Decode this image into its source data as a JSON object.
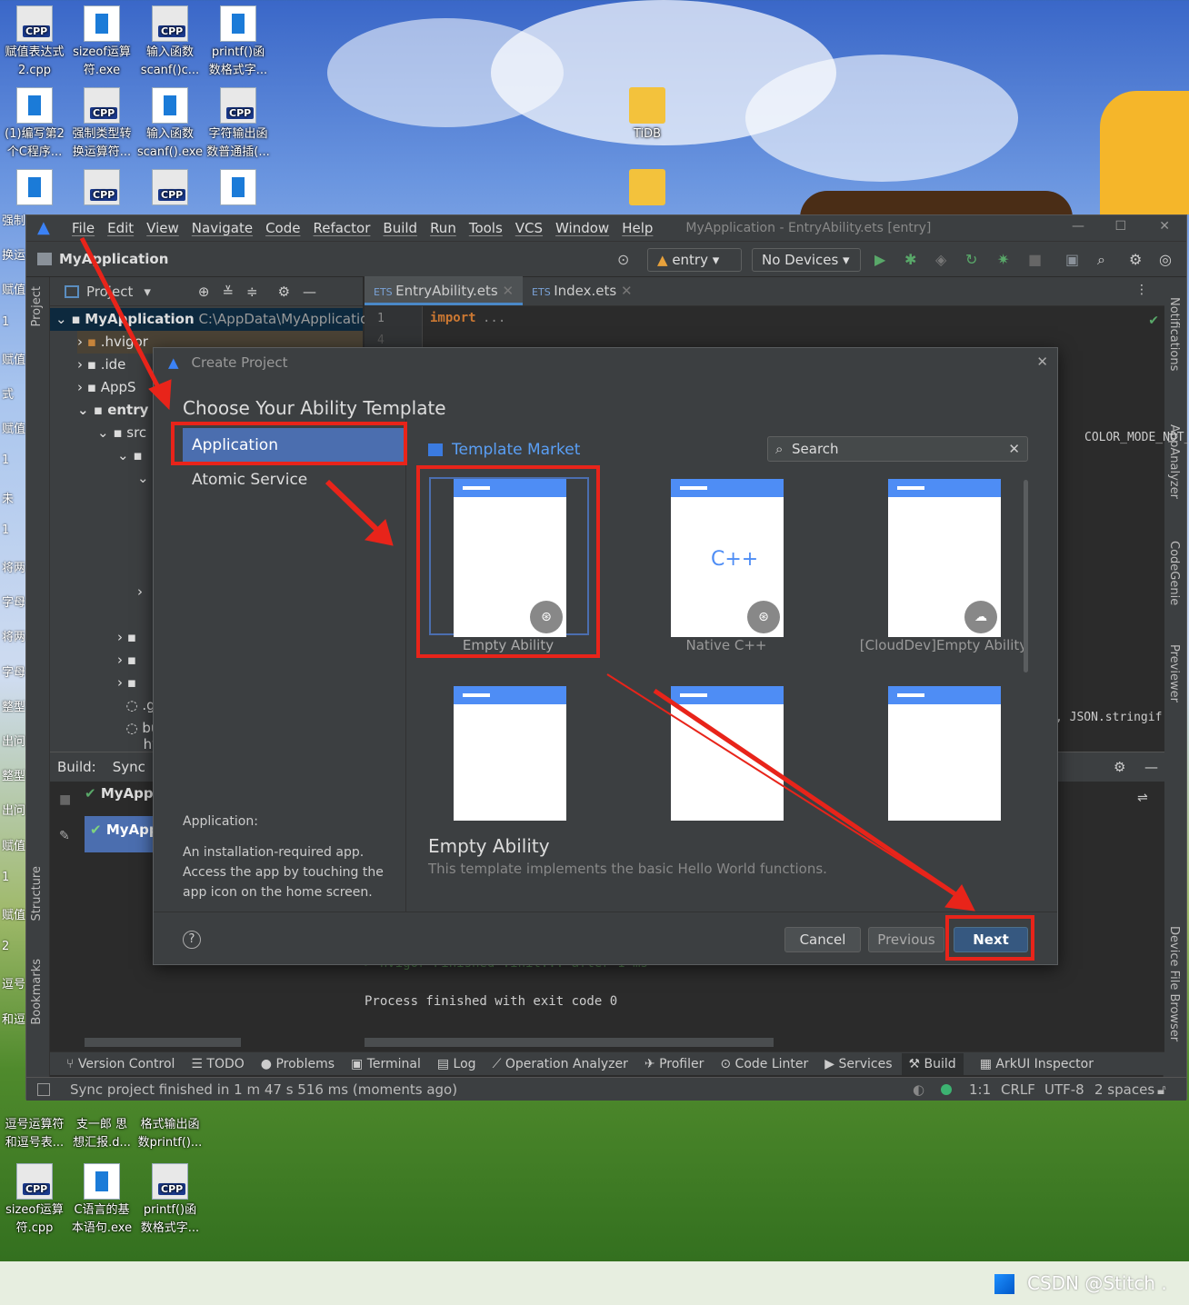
{
  "desktop": {
    "icons_top": [
      {
        "label1": "赋值表达式",
        "label2": "2.cpp",
        "type": "cpp"
      },
      {
        "label1": "sizeof运算",
        "label2": "符.exe",
        "type": "exe"
      },
      {
        "label1": "输入函数",
        "label2": "scanf()c...",
        "type": "cpp"
      },
      {
        "label1": "printf()函",
        "label2": "数格式字...",
        "type": "exe"
      },
      {
        "label1": "(1)编写第2",
        "label2": "个C程序...",
        "type": "exe"
      },
      {
        "label1": "强制类型转",
        "label2": "换运算符...",
        "type": "cpp"
      },
      {
        "label1": "输入函数",
        "label2": "scanf().exe",
        "type": "exe"
      },
      {
        "label1": "字符输出函",
        "label2": "数普通插(...",
        "type": "cpp"
      }
    ],
    "tidb_label": "TiDB",
    "icons_bottom": [
      {
        "label1": "逗号运算符",
        "label2": "和逗号表..."
      },
      {
        "label1": "支一郎 思",
        "label2": "想汇报.d..."
      },
      {
        "label1": "格式输出函",
        "label2": "数printf()..."
      },
      {
        "label1": "sizeof运算",
        "label2": "符.cpp",
        "type": "cpp"
      },
      {
        "label1": "C语言的基",
        "label2": "本语句.exe",
        "type": "exe"
      },
      {
        "label1": "printf()函",
        "label2": "数格式字...",
        "type": "cpp"
      }
    ],
    "left_partial": [
      "强制",
      "换运",
      "赋值",
      "1",
      "赋值",
      "式",
      "赋值",
      "1",
      "未",
      "1",
      "将两",
      "字母",
      "将两",
      "字母",
      "整型",
      "出问",
      "整型",
      "出问",
      "赋值",
      "1",
      "赋值",
      "2",
      "逗号",
      "和逗"
    ]
  },
  "ide": {
    "menu": [
      "File",
      "Edit",
      "View",
      "Navigate",
      "Code",
      "Refactor",
      "Build",
      "Run",
      "Tools",
      "VCS",
      "Window",
      "Help"
    ],
    "window_title": "MyApplication - EntryAbility.ets [entry]",
    "project_name": "MyApplication",
    "run_config": "entry",
    "device": "No Devices",
    "project_panel_label": "Project",
    "tree_root": "MyApplication",
    "tree_root_path": "C:\\AppData\\MyApplication",
    "tree": [
      ".hvigor",
      ".ide",
      "AppS",
      "entry",
      "src"
    ],
    "tree_partial": [
      ".gi",
      "bu",
      "hv"
    ],
    "tabs": [
      "EntryAbility.ets",
      "Index.ets"
    ],
    "gutter_lines": [
      "1",
      "4"
    ],
    "code_keyword": "import",
    "code_ellipsis": "...",
    "code_right1": "COLOR_MODE_NOT_",
    "code_right2": ", JSON.stringif",
    "build_tab": "Build:",
    "sync_tab": "Sync",
    "build_items": [
      "MyApp",
      "MyApp"
    ],
    "console_dim": "> hvigor Finished :init... after 1 ms",
    "console_line": "Process finished with exit code 0",
    "left_strip": [
      "Project",
      "Structure",
      "Bookmarks"
    ],
    "right_strip": [
      "Notifications",
      "AppAnalyzer",
      "CodeGenie",
      "Previewer",
      "Device File Browser"
    ],
    "tool_windows": [
      "Version Control",
      "TODO",
      "Problems",
      "Terminal",
      "Log",
      "Operation Analyzer",
      "Profiler",
      "Code Linter",
      "Services",
      "Build",
      "ArkUI Inspector"
    ],
    "status_text": "Sync project finished in 1 m 47 s 516 ms (moments ago)",
    "status_right": [
      "1:1",
      "CRLF",
      "UTF-8",
      "2 spaces"
    ]
  },
  "dialog": {
    "title": "Create Project",
    "heading": "Choose Your Ability Template",
    "categories": [
      "Application",
      "Atomic Service"
    ],
    "category_desc_title": "Application:",
    "category_desc": "An installation-required app. Access the app by touching the app icon on the home screen.",
    "market": "Template Market",
    "search_placeholder": "Search",
    "templates": [
      "Empty Ability",
      "Native C++",
      "[CloudDev]Empty Ability"
    ],
    "selected_title": "Empty Ability",
    "selected_desc": "This template implements the basic Hello World functions.",
    "help": "?",
    "cancel": "Cancel",
    "previous": "Previous",
    "next": "Next"
  },
  "taskbar": {
    "watermark": "CSDN @Stitch ."
  },
  "colors": {
    "accent": "#4b6eaf",
    "next_button": "#365880",
    "annotation_red": "#e8241a",
    "link_blue": "#5a9ff5"
  }
}
